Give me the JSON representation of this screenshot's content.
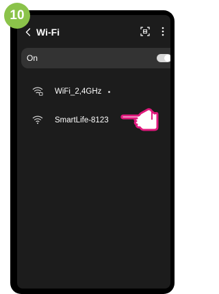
{
  "step": {
    "number": "10",
    "color": "#8bc34a"
  },
  "header": {
    "back_icon": "chevron-left-icon",
    "title": "Wi-Fi",
    "scan_icon": "qr-scan-icon",
    "more_icon": "more-vertical-icon"
  },
  "wifi_toggle": {
    "label": "On",
    "state": "on"
  },
  "networks": [
    {
      "name": "WiFi_2,4GHz",
      "icon": "wifi-lock-icon",
      "secured": true
    },
    {
      "name": "SmartLife-8123",
      "icon": "wifi-icon",
      "secured": false
    }
  ],
  "pointer": {
    "icon": "pointing-hand-icon",
    "outline_color": "#e0197d"
  }
}
